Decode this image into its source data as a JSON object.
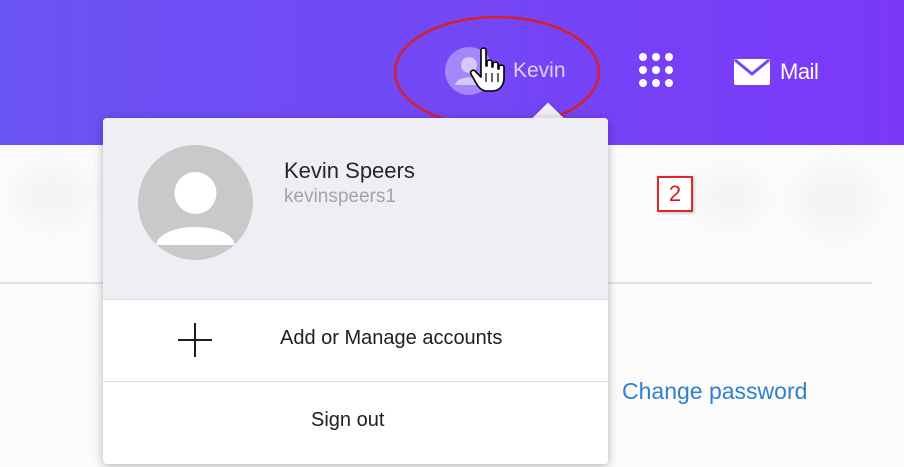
{
  "header": {
    "user_name": "Kevin",
    "mail_label": "Mail"
  },
  "dropdown": {
    "display_name": "Kevin Speers",
    "username": "kevinspeers1",
    "menu": {
      "add_accounts_label": "Add or Manage accounts",
      "sign_out_label": "Sign out"
    }
  },
  "page": {
    "change_password_label": "Change password"
  },
  "annotation": {
    "step_number": "2"
  },
  "icons": {
    "user": "user-icon",
    "cursor": "hand-cursor-icon",
    "apps": "apps-grid-icon",
    "mail": "mail-icon",
    "plus": "plus-icon",
    "avatar": "avatar-icon"
  },
  "colors": {
    "header_gradient_start": "#6a53f4",
    "header_gradient_end": "#7b38f8",
    "link": "#2f7fd0",
    "annotation": "#e0262b"
  }
}
